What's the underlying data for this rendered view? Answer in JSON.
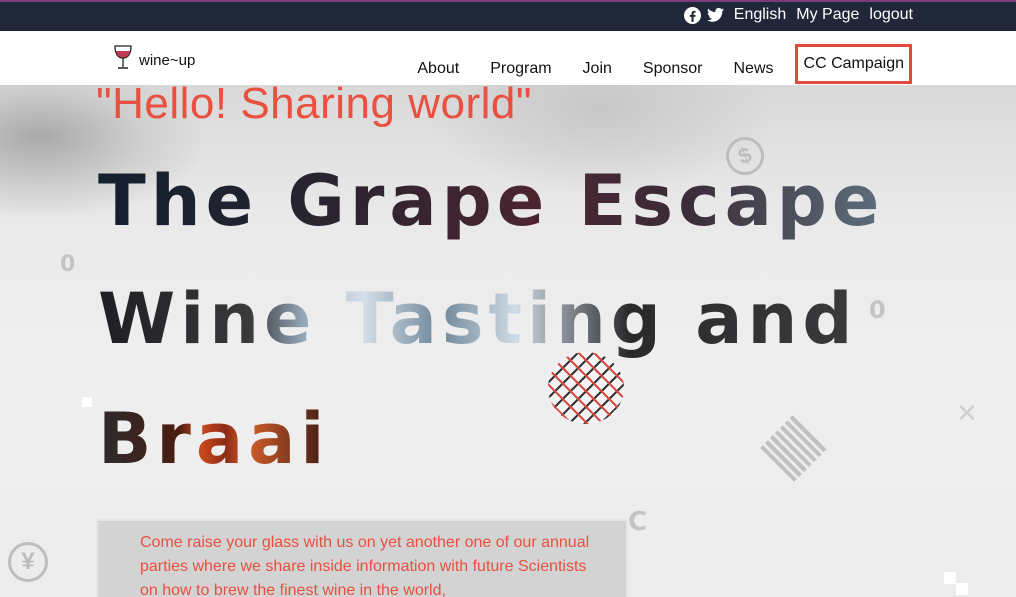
{
  "topbar": {
    "facebook_icon": "facebook-icon",
    "twitter_icon": "twitter-icon",
    "links": [
      "English",
      "My Page",
      "logout"
    ]
  },
  "brand": {
    "logo_icon": "wine-glass-icon",
    "name": "wine~up"
  },
  "nav": {
    "items": [
      "About",
      "Program",
      "Join",
      "Sponsor",
      "News"
    ],
    "highlighted": "CC Campaign"
  },
  "hero": {
    "tagline": "\"Hello! Sharing world\"",
    "title_lines": [
      "The Grape Escape",
      "Wine Tasting and",
      "Braai"
    ],
    "decorations": {
      "zero": "0",
      "c": "C",
      "dollar": "$",
      "yen": "¥",
      "close": "✕"
    },
    "description": "Come raise your glass with us on yet another one of our annual parties where we share inside information with future Scientists on how to brew the finest wine in the world,"
  },
  "colors": {
    "accent": "#e8503f",
    "topbar_bg": "#1f2738",
    "highlight_border": "#e24a3b"
  }
}
